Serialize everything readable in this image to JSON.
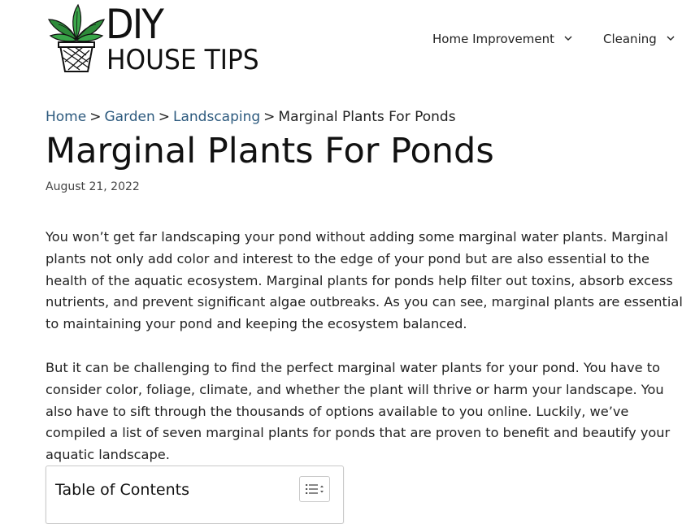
{
  "logo": {
    "line1": "DIY",
    "line2": "HOUSE TIPS"
  },
  "nav": {
    "items": [
      {
        "label": "Home Improvement"
      },
      {
        "label": "Cleaning"
      }
    ]
  },
  "breadcrumb": {
    "items": [
      "Home",
      "Garden",
      "Landscaping"
    ],
    "separator": ">",
    "current": "Marginal Plants For Ponds"
  },
  "article": {
    "title": "Marginal Plants For Ponds",
    "date": "August 21, 2022",
    "paragraphs": [
      "You won’t get far landscaping your pond without adding some marginal water plants. Marginal plants not only add color and interest to the edge of your pond but are also essential to the health of the aquatic ecosystem. Marginal plants for ponds help filter out toxins, absorb excess nutrients, and prevent significant algae outbreaks. As you can see, marginal plants are essential to maintaining your pond and keeping the ecosystem balanced.",
      "But it can be challenging to find the perfect marginal water plants for your pond. You have to consider color, foliage, climate, and whether the plant will thrive or harm your landscape. You also have to sift through the thousands of options available to you online. Luckily, we’ve compiled a list of seven marginal plants for ponds that are proven to benefit and beautify your aquatic landscape."
    ]
  },
  "toc": {
    "title": "Table of Contents",
    "toggle_icon": "list-toggle-icon"
  },
  "colors": {
    "link": "#2d5a7e",
    "text": "#222222",
    "leaf_green": "#2e8b3a"
  }
}
